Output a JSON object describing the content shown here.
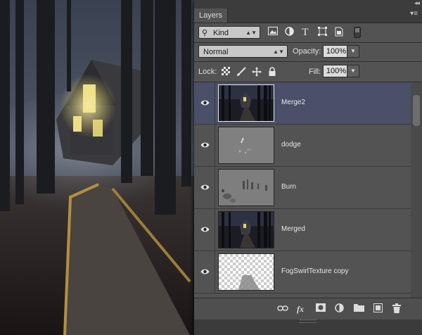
{
  "panel": {
    "tab_label": "Layers",
    "collapse_glyph": "◂◂",
    "menu_glyph": "▾≡"
  },
  "filter": {
    "kind_label": "Kind",
    "icons": [
      "image-filter-icon",
      "adjustment-filter-icon",
      "type-filter-icon",
      "shape-filter-icon",
      "smart-object-filter-icon",
      "filter-toggle-icon"
    ]
  },
  "blend": {
    "mode": "Normal",
    "opacity_label": "Opacity:",
    "opacity_value": "100%"
  },
  "lock": {
    "label": "Lock:",
    "fill_label": "Fill:",
    "fill_value": "100%",
    "icons": [
      "lock-transparent-icon",
      "lock-paint-icon",
      "lock-move-icon",
      "lock-all-icon"
    ]
  },
  "layers": [
    {
      "name": "Merge2",
      "selected": true,
      "thumb": "forest-scene"
    },
    {
      "name": "dodge",
      "selected": false,
      "thumb": "gray-dodge"
    },
    {
      "name": "Burn",
      "selected": false,
      "thumb": "gray-burn"
    },
    {
      "name": "Merged",
      "selected": false,
      "thumb": "forest-scene"
    },
    {
      "name": "FogSwirlTexture copy",
      "selected": false,
      "thumb": "transparent-fog"
    }
  ],
  "bottom_icons": [
    "link-layers-icon",
    "fx-icon",
    "add-mask-icon",
    "adjustment-layer-icon",
    "new-group-icon",
    "new-layer-icon",
    "delete-layer-icon"
  ],
  "colors": {
    "panel_bg": "#535353",
    "selected_row": "#4b5068",
    "tab_strip": "#3c3c3c"
  }
}
